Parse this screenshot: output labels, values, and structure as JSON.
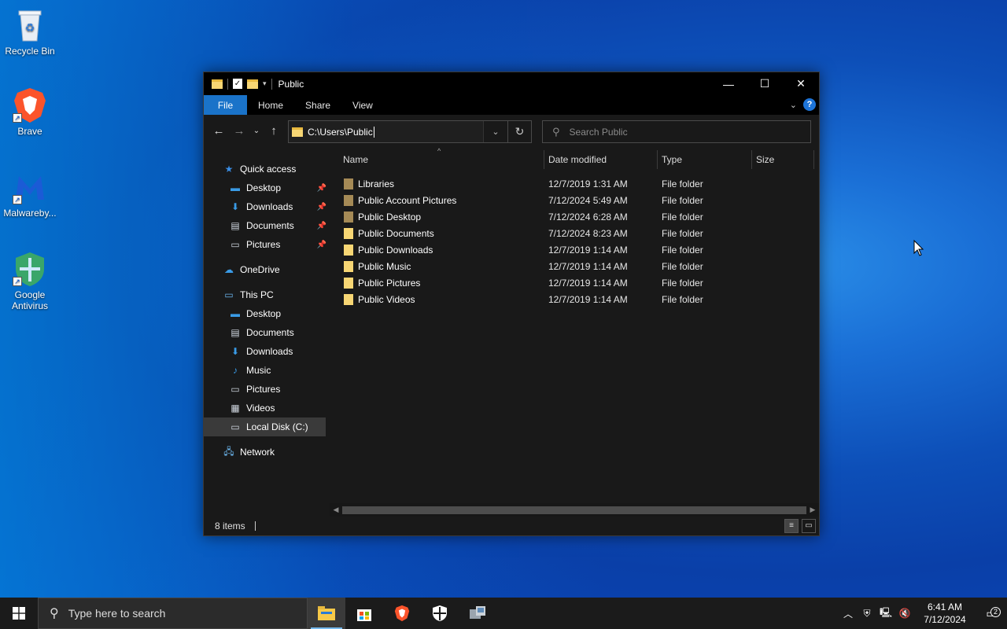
{
  "desktop": {
    "icons": [
      {
        "label": "Recycle Bin",
        "icon": "recycle-bin-icon"
      },
      {
        "label": "Brave",
        "icon": "brave-icon"
      },
      {
        "label": "Malwareby...",
        "icon": "malwarebytes-icon"
      },
      {
        "label": "Google Antivirus",
        "icon": "google-antivirus-icon"
      }
    ]
  },
  "window": {
    "title": "Public",
    "controls": {
      "minimize": "—",
      "maximize": "☐",
      "close": "✕"
    },
    "ribbon_tabs": [
      "File",
      "Home",
      "Share",
      "View"
    ],
    "address": "C:\\Users\\Public",
    "search_placeholder": "Search Public",
    "columns": [
      "Name",
      "Date modified",
      "Type",
      "Size"
    ],
    "nav": {
      "quick_access": {
        "label": "Quick access",
        "items": [
          {
            "label": "Desktop",
            "pinned": true
          },
          {
            "label": "Downloads",
            "pinned": true
          },
          {
            "label": "Documents",
            "pinned": true
          },
          {
            "label": "Pictures",
            "pinned": true
          }
        ]
      },
      "onedrive": "OneDrive",
      "this_pc": {
        "label": "This PC",
        "items": [
          {
            "label": "Desktop"
          },
          {
            "label": "Documents"
          },
          {
            "label": "Downloads"
          },
          {
            "label": "Music"
          },
          {
            "label": "Pictures"
          },
          {
            "label": "Videos"
          },
          {
            "label": "Local Disk (C:)",
            "selected": true
          }
        ]
      },
      "network": "Network"
    },
    "files": [
      {
        "name": "Libraries",
        "date": "12/7/2019 1:31 AM",
        "type": "File folder",
        "special": true
      },
      {
        "name": "Public Account Pictures",
        "date": "7/12/2024 5:49 AM",
        "type": "File folder",
        "special": true
      },
      {
        "name": "Public Desktop",
        "date": "7/12/2024 6:28 AM",
        "type": "File folder",
        "special": true
      },
      {
        "name": "Public Documents",
        "date": "7/12/2024 8:23 AM",
        "type": "File folder",
        "special": false
      },
      {
        "name": "Public Downloads",
        "date": "12/7/2019 1:14 AM",
        "type": "File folder",
        "special": false
      },
      {
        "name": "Public Music",
        "date": "12/7/2019 1:14 AM",
        "type": "File folder",
        "special": false
      },
      {
        "name": "Public Pictures",
        "date": "12/7/2019 1:14 AM",
        "type": "File folder",
        "special": false
      },
      {
        "name": "Public Videos",
        "date": "12/7/2019 1:14 AM",
        "type": "File folder",
        "special": false
      }
    ],
    "status": {
      "item_count": "8 items"
    }
  },
  "taskbar": {
    "search_placeholder": "Type here to search",
    "apps": [
      "file-explorer-icon",
      "store-icon",
      "brave-icon",
      "security-shield-icon",
      "network-app-icon"
    ],
    "clock": {
      "time": "6:41 AM",
      "date": "7/12/2024"
    },
    "notification_count": "2"
  },
  "colors": {
    "accent": "#1a73c9",
    "folder": "#f7d674",
    "special_folder": "#a58a56",
    "window_bg": "#191919",
    "taskbar_bg": "#1b1b1b"
  }
}
